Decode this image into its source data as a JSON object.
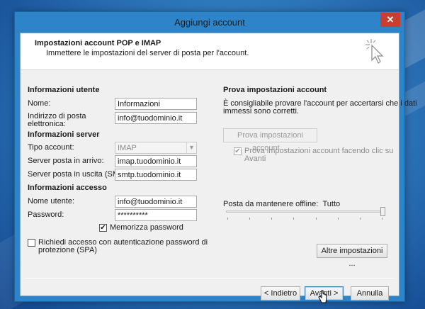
{
  "window": {
    "title": "Aggiungi account",
    "close_glyph": "✕"
  },
  "header": {
    "title": "Impostazioni account POP e IMAP",
    "subtitle": "Immettere le impostazioni del server di posta per l'account.",
    "icon": "wizard-cursor-icon"
  },
  "user_info": {
    "heading": "Informazioni utente",
    "name_label": "Nome:",
    "name_value": "Informazioni",
    "email_label_1": "Indirizzo di posta",
    "email_label_2": "elettronica:",
    "email_value": "info@tuodominio.it"
  },
  "server_info": {
    "heading": "Informazioni server",
    "account_type_label": "Tipo account:",
    "account_type_value": "IMAP",
    "incoming_label": "Server posta in arrivo:",
    "incoming_value": "imap.tuodominio.it",
    "outgoing_label": "Server posta in uscita (SMTP):",
    "outgoing_value": "smtp.tuodominio.it"
  },
  "access_info": {
    "heading": "Informazioni accesso",
    "username_label": "Nome utente:",
    "username_value": "info@tuodominio.it",
    "password_label": "Password:",
    "password_value": "**********",
    "remember_label": "Memorizza password",
    "remember_checked": true,
    "spa_label_1": "Richiedi accesso con autenticazione password di",
    "spa_label_2": "protezione (SPA)",
    "spa_checked": false
  },
  "test_settings": {
    "heading": "Prova impostazioni account",
    "description_1": "È consigliabile provare l'account per accertarsi che i dati",
    "description_2": "immessi sono corretti.",
    "test_button": "Prova impostazioni account ...",
    "auto_test_label_1": "Prova impostazioni account facendo clic su",
    "auto_test_label_2": "Avanti",
    "auto_test_checked": true
  },
  "offline": {
    "label": "Posta da mantenere offline:",
    "value": "Tutto",
    "slider_level": 1.0
  },
  "buttons": {
    "more_settings": "Altre impostazioni ...",
    "back": "< Indietro",
    "next": "Avanti >",
    "cancel": "Annulla"
  },
  "colors": {
    "close": "#c7402f",
    "titlebar": "#2e84c8",
    "desktop": "#2f79bd"
  }
}
